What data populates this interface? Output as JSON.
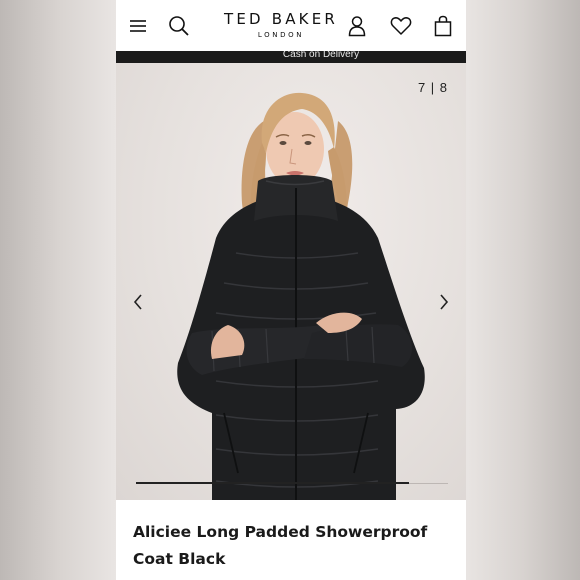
{
  "header": {
    "brand": "TED BAKER",
    "brand_sub": "LONDON",
    "icons": [
      "menu-icon",
      "search-icon",
      "account-icon",
      "heart-icon",
      "bag-icon"
    ]
  },
  "promo": {
    "text": "Cash on Delivery"
  },
  "gallery": {
    "counter": "7 | 8",
    "current_image": 7,
    "total_images": 8,
    "progress_fraction": 0.875
  },
  "product": {
    "title": "Aliciee Long Padded Showerproof Coat Black"
  },
  "colors": {
    "promo_bg": "#1b1b1b",
    "gallery_bg": "#e6e1de",
    "coat": "#1e1f21",
    "text": "#1a1a1a"
  }
}
